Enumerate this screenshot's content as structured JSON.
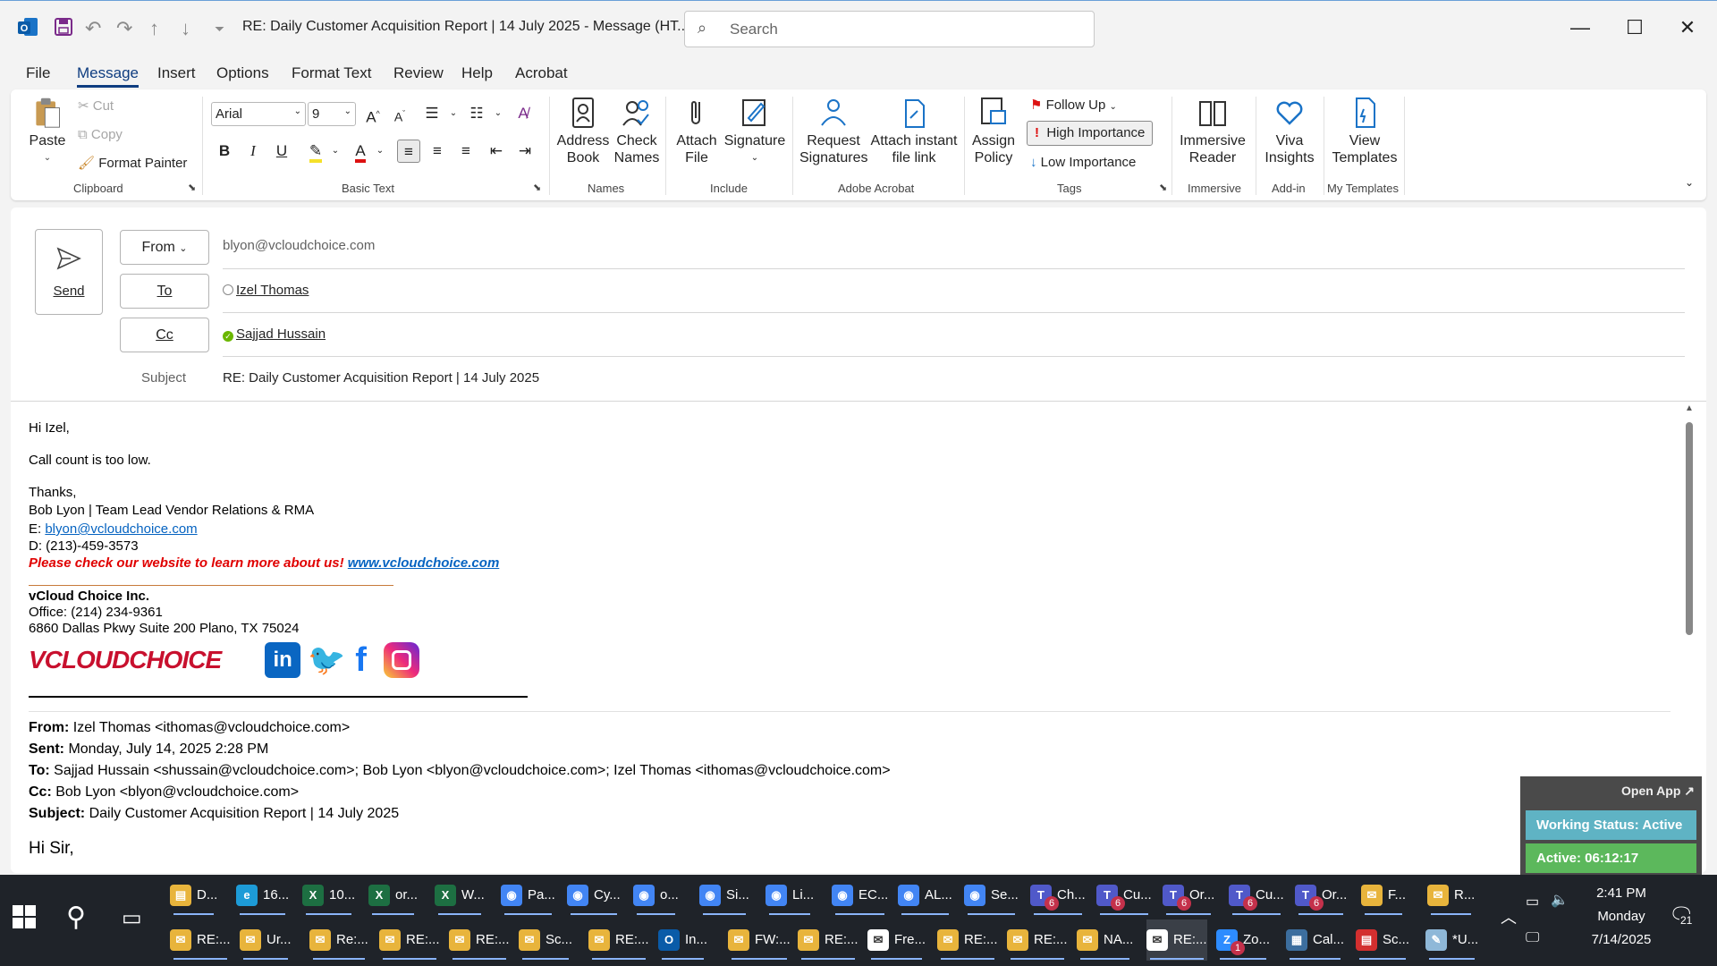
{
  "window": {
    "title": "RE: Daily Customer Acquisition Report | 14 July 2025  -  Message (HT...",
    "search_placeholder": "Search"
  },
  "menu_tabs": [
    "File",
    "Message",
    "Insert",
    "Options",
    "Format Text",
    "Review",
    "Help",
    "Acrobat"
  ],
  "ribbon": {
    "clipboard": {
      "paste": "Paste",
      "cut": "Cut",
      "copy": "Copy",
      "format_painter": "Format Painter",
      "label": "Clipboard"
    },
    "basic_text": {
      "font": "Arial",
      "size": "9",
      "label": "Basic Text"
    },
    "names": {
      "address_book": "Address Book",
      "check_names": "Check Names",
      "label": "Names"
    },
    "include": {
      "attach_file": "Attach File",
      "signature": "Signature",
      "label": "Include"
    },
    "adobe": {
      "request_signatures": "Request Signatures",
      "attach_instant": "Attach instant file link",
      "label": "Adobe Acrobat"
    },
    "tags": {
      "assign_policy": "Assign Policy",
      "follow_up": "Follow Up",
      "high_importance": "High Importance",
      "low_importance": "Low Importance",
      "label": "Tags"
    },
    "immersive": {
      "reader": "Immersive Reader",
      "label": "Immersive"
    },
    "addin": {
      "viva": "Viva Insights",
      "label": "Add-in"
    },
    "templates": {
      "view": "View Templates",
      "label": "My Templates"
    }
  },
  "compose": {
    "send": "Send",
    "from_label": "From",
    "from_value": "blyon@vcloudchoice.com",
    "to_label": "To",
    "to_value": "Izel Thomas",
    "cc_label": "Cc",
    "cc_value": "Sajjad Hussain",
    "subject_label": "Subject",
    "subject_value": "RE: Daily Customer Acquisition Report | 14 July 2025"
  },
  "body": {
    "greeting": "Hi Izel,",
    "message": "Call count is too low.",
    "thanks": "Thanks,",
    "sig_name": "Bob Lyon | Team Lead Vendor Relations & RMA",
    "sig_email_prefix": "E: ",
    "sig_email": "blyon@vcloudchoice.com",
    "sig_phone": "D: (213)-459-3573",
    "sig_promo": "Please check our website to learn more about us!",
    "sig_website": "www.vcloudchoice.com",
    "company": "vCloud Choice Inc.",
    "office": "Office: (214) 234-9361",
    "address": "6860 Dallas Pkwy Suite 200 Plano, TX 75024",
    "logo_text": "VCLOUDCHOICE",
    "quoted": {
      "from_label": "From:",
      "from": "Izel Thomas <ithomas@vcloudchoice.com>",
      "sent_label": "Sent:",
      "sent": "Monday, July 14, 2025 2:28 PM",
      "to_label": "To:",
      "to": "Sajjad Hussain <shussain@vcloudchoice.com>; Bob Lyon <blyon@vcloudchoice.com>; Izel Thomas <ithomas@vcloudchoice.com>",
      "cc_label": "Cc:",
      "cc": "Bob Lyon <blyon@vcloudchoice.com>",
      "subject_label": "Subject:",
      "subject": "Daily Customer Acquisition Report | 14 July 2025",
      "greeting": "Hi Sir,"
    }
  },
  "status_widget": {
    "open_app": "Open App ↗",
    "working_status": "Working Status: Active",
    "active_timer": "Active: 06:12:17"
  },
  "taskbar": {
    "row1": [
      "D...",
      "16...",
      "10...",
      "or...",
      "W...",
      "Pa...",
      "Cy...",
      "o...",
      "Si...",
      "Li...",
      "EC...",
      "AL...",
      "Se...",
      "Ch...",
      "Cu...",
      "Or...",
      "Cu...",
      "Or...",
      "F...",
      "R..."
    ],
    "row2": [
      "RE:...",
      "Ur...",
      "Re:...",
      "RE:...",
      "RE:...",
      "Sc...",
      "RE:...",
      "In...",
      "FW:...",
      "RE:...",
      "Fre...",
      "RE:...",
      "RE:...",
      "NA...",
      "RE:...",
      "Zo...",
      "Cal...",
      "Sc...",
      "*U..."
    ],
    "time": "2:41 PM",
    "day": "Monday",
    "date": "7/14/2025",
    "notifications": "21",
    "teams_badge": "6",
    "zoom_badge": "1"
  },
  "colors": {
    "accent": "#0f3d80",
    "link": "#0563c1",
    "promo_red": "#e00000",
    "widget_green": "#5cb85c",
    "widget_teal": "#5fb3c4"
  }
}
